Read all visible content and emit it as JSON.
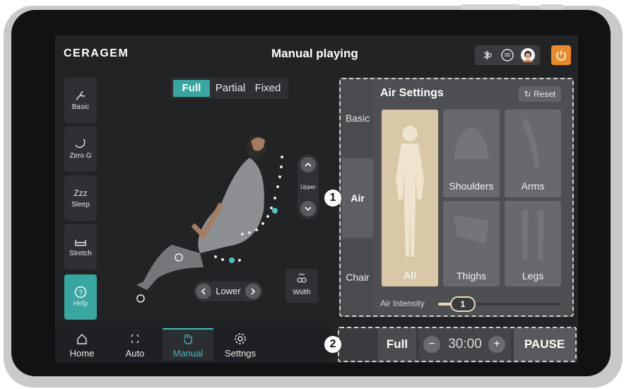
{
  "header": {
    "logo": "CERAGEM",
    "title": "Manual playing"
  },
  "left_menu": [
    {
      "label": "Basic",
      "icon": "chair-icon"
    },
    {
      "label": "Zero G",
      "icon": "zero-g-icon"
    },
    {
      "label": "Sleep",
      "icon": "sleep-icon"
    },
    {
      "label": "Stretch",
      "icon": "stretch-icon"
    },
    {
      "label": "Help",
      "icon": "help-icon"
    }
  ],
  "mode_tabs": [
    "Full",
    "Partial",
    "Fixed"
  ],
  "controls": {
    "upper": "Upper",
    "lower": "Lower",
    "width": "Width"
  },
  "air_panel": {
    "title": "Air Settings",
    "reset": "Reset",
    "side_tabs": [
      "Basic",
      "Air",
      "Chair"
    ],
    "tiles": [
      "All",
      "Shoulders",
      "Arms",
      "Thighs",
      "Legs"
    ],
    "intensity_label": "Air Intensity",
    "intensity_value": "1",
    "intensity_fraction": 0.2
  },
  "bottom_nav": [
    "Home",
    "Auto",
    "Manual",
    "Settngs"
  ],
  "bottom_ctrl": {
    "mode": "Full",
    "time": "30:00",
    "pause": "PAUSE"
  },
  "markers": [
    "1",
    "2"
  ],
  "colors": {
    "accent": "#3aa6a2",
    "power": "#e88b2e"
  }
}
